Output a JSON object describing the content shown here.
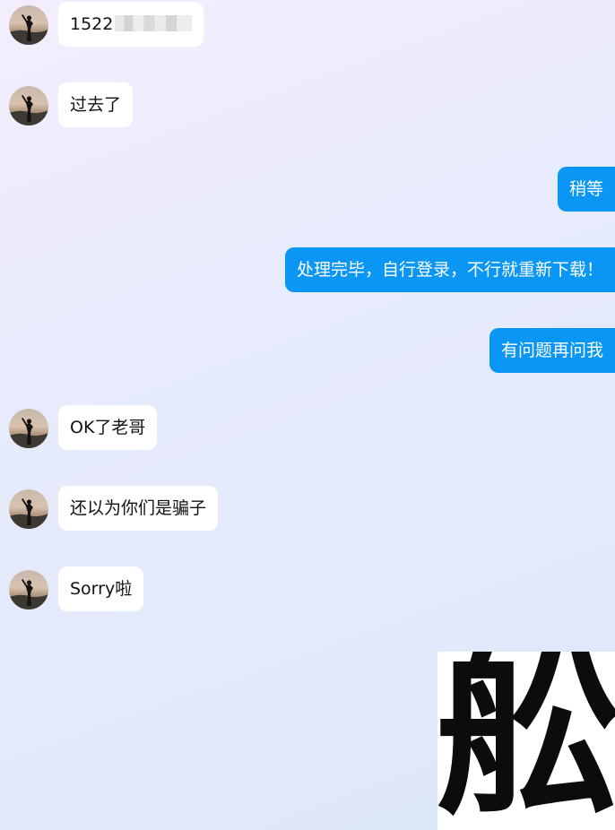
{
  "messages": [
    {
      "side": "left",
      "text": "1522",
      "masked_suffix": true
    },
    {
      "side": "left",
      "text": "过去了"
    },
    {
      "side": "right",
      "text": "稍等"
    },
    {
      "side": "right",
      "text": "处理完毕，自行登录，不行就重新下载！"
    },
    {
      "side": "right",
      "text": "有问题再问我"
    },
    {
      "side": "left",
      "text": "OK了老哥"
    },
    {
      "side": "left",
      "text": "还以为你们是骗子"
    },
    {
      "side": "left",
      "text": "Sorry啦"
    }
  ],
  "sticker": {
    "glyph": "舩"
  },
  "colors": {
    "outgoing_bubble": "#0a96f5",
    "incoming_bubble": "#ffffff",
    "background_top": "#f3eefe",
    "background_bottom": "#dde8fb"
  },
  "icons": {
    "avatar": "person-silhouette-sunset-avatar"
  }
}
